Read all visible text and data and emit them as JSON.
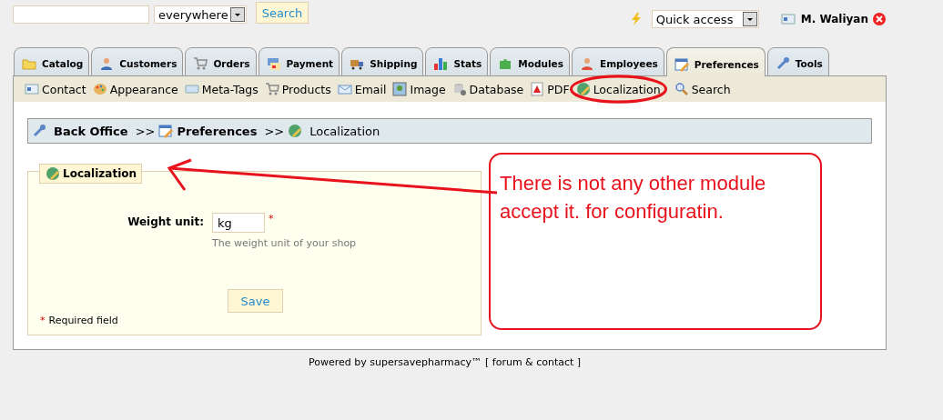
{
  "header": {
    "scope": "everywhere",
    "search_button": "Search",
    "quick_access": "Quick access",
    "user": "M. Waliyan"
  },
  "tabs": [
    {
      "label": "Catalog",
      "selected": false
    },
    {
      "label": "Customers",
      "selected": false
    },
    {
      "label": "Orders",
      "selected": false
    },
    {
      "label": "Payment",
      "selected": false
    },
    {
      "label": "Shipping",
      "selected": false
    },
    {
      "label": "Stats",
      "selected": false
    },
    {
      "label": "Modules",
      "selected": false
    },
    {
      "label": "Employees",
      "selected": false
    },
    {
      "label": "Preferences",
      "selected": true
    },
    {
      "label": "Tools",
      "selected": false
    }
  ],
  "subtabs": [
    "Contact",
    "Appearance",
    "Meta-Tags",
    "Products",
    "Email",
    "Image",
    "Database",
    "PDF",
    "Localization",
    "Search"
  ],
  "breadcrumb": [
    {
      "label": "Back Office",
      "bold": true
    },
    {
      "label": ">>",
      "bold": false
    },
    {
      "label": "Preferences",
      "bold": true
    },
    {
      "label": ">>",
      "bold": false
    },
    {
      "label": "Localization",
      "bold": false
    }
  ],
  "form": {
    "legend": "Localization",
    "label": "Weight unit:",
    "value": "kg",
    "required_mark": "*",
    "hint": "The weight unit of your shop",
    "save_button": "Save",
    "required_note_mark": "*",
    "required_note": "Required field"
  },
  "annotation": {
    "text": "There is not any other module accept it. for configuratin."
  },
  "footer": {
    "text": "Powered by supersavepharmacy™",
    "link": "[ forum & contact ]"
  }
}
